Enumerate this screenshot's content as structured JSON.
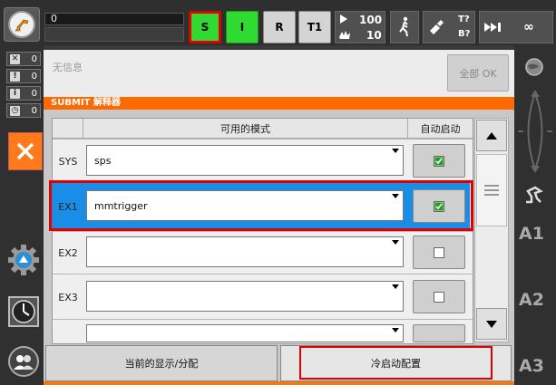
{
  "status_bar": {
    "program_number": "0",
    "buttons": {
      "s": "S",
      "i": "I",
      "r": "R",
      "t1": "T1"
    },
    "override": {
      "program": "100",
      "jog": "10"
    },
    "tool": {
      "tool": "T?",
      "base": "B?"
    },
    "run_mode": "∞"
  },
  "messages": {
    "counts": [
      "0",
      "0",
      "0",
      "0"
    ],
    "text": "无信息",
    "ack_all_label": "全部 OK"
  },
  "submit": {
    "title": "SUBMIT 解释器",
    "columns": {
      "mode": "可用的模式",
      "autostart": "自动启动"
    },
    "rows": [
      {
        "label": "SYS",
        "value": "sps",
        "autostart": true
      },
      {
        "label": "EX1",
        "value": "mmtrigger",
        "autostart": true
      },
      {
        "label": "EX2",
        "value": "",
        "autostart": false
      },
      {
        "label": "EX3",
        "value": "",
        "autostart": false
      }
    ],
    "buttons": {
      "display": "当前的显示/分配",
      "cold_start": "冷启动配置"
    }
  },
  "right_axes": [
    "A1",
    "A2",
    "A3"
  ],
  "colors": {
    "accent": "#ff6a00",
    "selected": "#1a8de6",
    "highlight": "#e00000",
    "green": "#31d933"
  }
}
